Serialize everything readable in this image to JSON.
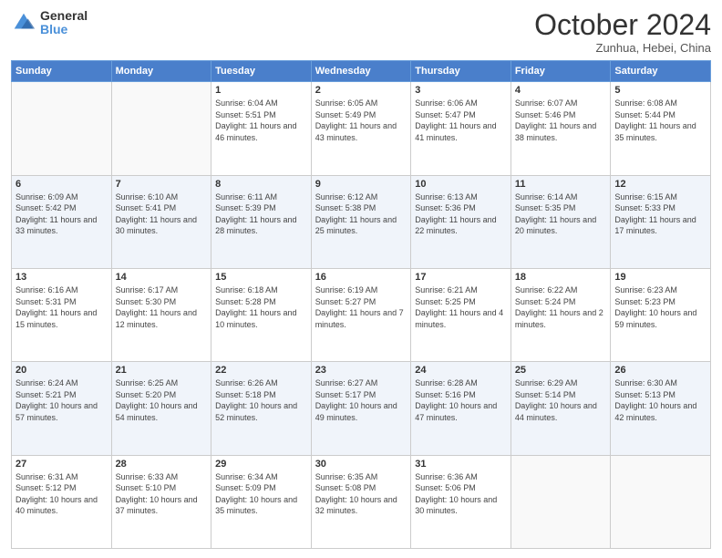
{
  "logo": {
    "general": "General",
    "blue": "Blue"
  },
  "header": {
    "month": "October 2024",
    "location": "Zunhua, Hebei, China"
  },
  "weekdays": [
    "Sunday",
    "Monday",
    "Tuesday",
    "Wednesday",
    "Thursday",
    "Friday",
    "Saturday"
  ],
  "weeks": [
    [
      {
        "day": "",
        "info": ""
      },
      {
        "day": "",
        "info": ""
      },
      {
        "day": "1",
        "info": "Sunrise: 6:04 AM\nSunset: 5:51 PM\nDaylight: 11 hours and 46 minutes."
      },
      {
        "day": "2",
        "info": "Sunrise: 6:05 AM\nSunset: 5:49 PM\nDaylight: 11 hours and 43 minutes."
      },
      {
        "day": "3",
        "info": "Sunrise: 6:06 AM\nSunset: 5:47 PM\nDaylight: 11 hours and 41 minutes."
      },
      {
        "day": "4",
        "info": "Sunrise: 6:07 AM\nSunset: 5:46 PM\nDaylight: 11 hours and 38 minutes."
      },
      {
        "day": "5",
        "info": "Sunrise: 6:08 AM\nSunset: 5:44 PM\nDaylight: 11 hours and 35 minutes."
      }
    ],
    [
      {
        "day": "6",
        "info": "Sunrise: 6:09 AM\nSunset: 5:42 PM\nDaylight: 11 hours and 33 minutes."
      },
      {
        "day": "7",
        "info": "Sunrise: 6:10 AM\nSunset: 5:41 PM\nDaylight: 11 hours and 30 minutes."
      },
      {
        "day": "8",
        "info": "Sunrise: 6:11 AM\nSunset: 5:39 PM\nDaylight: 11 hours and 28 minutes."
      },
      {
        "day": "9",
        "info": "Sunrise: 6:12 AM\nSunset: 5:38 PM\nDaylight: 11 hours and 25 minutes."
      },
      {
        "day": "10",
        "info": "Sunrise: 6:13 AM\nSunset: 5:36 PM\nDaylight: 11 hours and 22 minutes."
      },
      {
        "day": "11",
        "info": "Sunrise: 6:14 AM\nSunset: 5:35 PM\nDaylight: 11 hours and 20 minutes."
      },
      {
        "day": "12",
        "info": "Sunrise: 6:15 AM\nSunset: 5:33 PM\nDaylight: 11 hours and 17 minutes."
      }
    ],
    [
      {
        "day": "13",
        "info": "Sunrise: 6:16 AM\nSunset: 5:31 PM\nDaylight: 11 hours and 15 minutes."
      },
      {
        "day": "14",
        "info": "Sunrise: 6:17 AM\nSunset: 5:30 PM\nDaylight: 11 hours and 12 minutes."
      },
      {
        "day": "15",
        "info": "Sunrise: 6:18 AM\nSunset: 5:28 PM\nDaylight: 11 hours and 10 minutes."
      },
      {
        "day": "16",
        "info": "Sunrise: 6:19 AM\nSunset: 5:27 PM\nDaylight: 11 hours and 7 minutes."
      },
      {
        "day": "17",
        "info": "Sunrise: 6:21 AM\nSunset: 5:25 PM\nDaylight: 11 hours and 4 minutes."
      },
      {
        "day": "18",
        "info": "Sunrise: 6:22 AM\nSunset: 5:24 PM\nDaylight: 11 hours and 2 minutes."
      },
      {
        "day": "19",
        "info": "Sunrise: 6:23 AM\nSunset: 5:23 PM\nDaylight: 10 hours and 59 minutes."
      }
    ],
    [
      {
        "day": "20",
        "info": "Sunrise: 6:24 AM\nSunset: 5:21 PM\nDaylight: 10 hours and 57 minutes."
      },
      {
        "day": "21",
        "info": "Sunrise: 6:25 AM\nSunset: 5:20 PM\nDaylight: 10 hours and 54 minutes."
      },
      {
        "day": "22",
        "info": "Sunrise: 6:26 AM\nSunset: 5:18 PM\nDaylight: 10 hours and 52 minutes."
      },
      {
        "day": "23",
        "info": "Sunrise: 6:27 AM\nSunset: 5:17 PM\nDaylight: 10 hours and 49 minutes."
      },
      {
        "day": "24",
        "info": "Sunrise: 6:28 AM\nSunset: 5:16 PM\nDaylight: 10 hours and 47 minutes."
      },
      {
        "day": "25",
        "info": "Sunrise: 6:29 AM\nSunset: 5:14 PM\nDaylight: 10 hours and 44 minutes."
      },
      {
        "day": "26",
        "info": "Sunrise: 6:30 AM\nSunset: 5:13 PM\nDaylight: 10 hours and 42 minutes."
      }
    ],
    [
      {
        "day": "27",
        "info": "Sunrise: 6:31 AM\nSunset: 5:12 PM\nDaylight: 10 hours and 40 minutes."
      },
      {
        "day": "28",
        "info": "Sunrise: 6:33 AM\nSunset: 5:10 PM\nDaylight: 10 hours and 37 minutes."
      },
      {
        "day": "29",
        "info": "Sunrise: 6:34 AM\nSunset: 5:09 PM\nDaylight: 10 hours and 35 minutes."
      },
      {
        "day": "30",
        "info": "Sunrise: 6:35 AM\nSunset: 5:08 PM\nDaylight: 10 hours and 32 minutes."
      },
      {
        "day": "31",
        "info": "Sunrise: 6:36 AM\nSunset: 5:06 PM\nDaylight: 10 hours and 30 minutes."
      },
      {
        "day": "",
        "info": ""
      },
      {
        "day": "",
        "info": ""
      }
    ]
  ]
}
